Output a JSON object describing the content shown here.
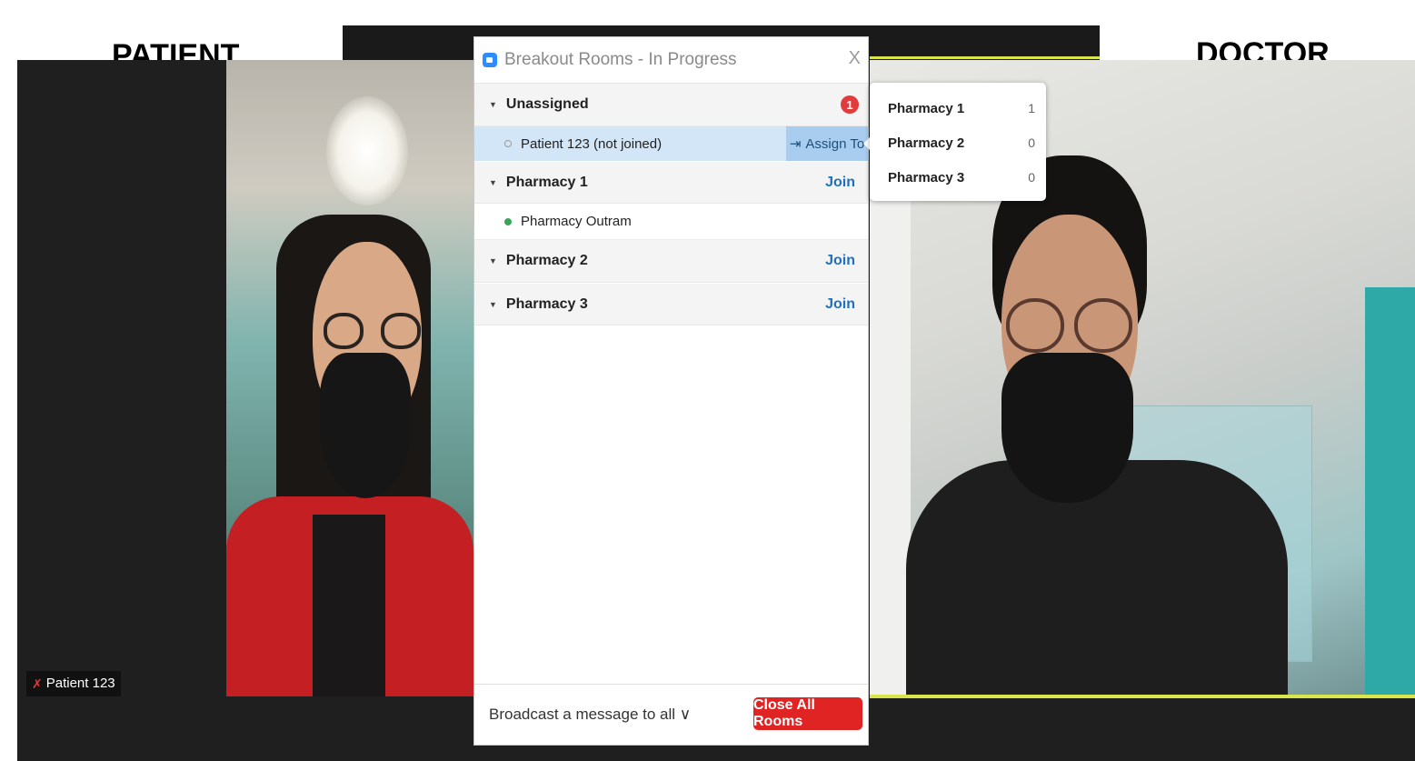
{
  "labels": {
    "patient": "PATIENT",
    "doctor": "DOCTOR"
  },
  "video": {
    "patient_name": "Patient 123"
  },
  "breakout": {
    "title": "Breakout Rooms - In Progress",
    "close_glyph": "X",
    "unassigned": {
      "label": "Unassigned",
      "count": "1"
    },
    "unassigned_member": {
      "name": "Patient 123 (not joined)",
      "assign_label": "Assign To"
    },
    "rooms": [
      {
        "label": "Pharmacy 1",
        "join": "Join",
        "members": [
          "Pharmacy Outram"
        ]
      },
      {
        "label": "Pharmacy 2",
        "join": "Join"
      },
      {
        "label": "Pharmacy 3",
        "join": "Join"
      }
    ],
    "broadcast": "Broadcast a message to all ∨",
    "close_all": "Close All Rooms"
  },
  "assign_popup": [
    {
      "name": "Pharmacy 1",
      "count": "1"
    },
    {
      "name": "Pharmacy 2",
      "count": "0"
    },
    {
      "name": "Pharmacy 3",
      "count": "0"
    }
  ],
  "colors": {
    "accent_blue": "#1f6fbf",
    "close_red": "#e02424",
    "speaker_border": "#d8e64b"
  }
}
